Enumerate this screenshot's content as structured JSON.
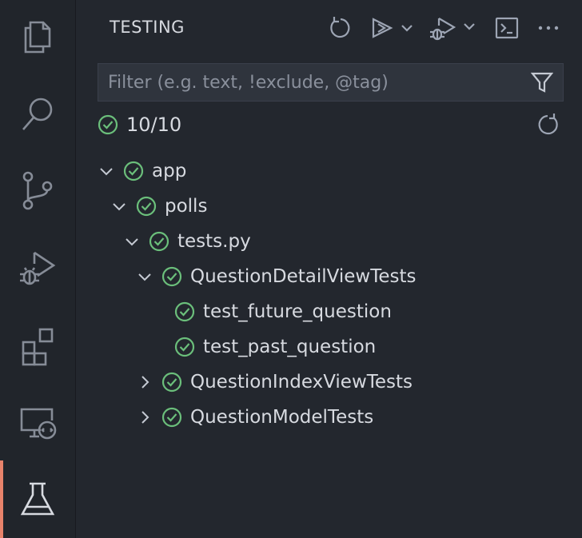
{
  "sidebar": {
    "title": "TESTING",
    "filter_placeholder": "Filter (e.g. text, !exclude, @tag)",
    "filter_value": "",
    "summary": {
      "status": "passed",
      "count": "10/10"
    }
  },
  "tree": [
    {
      "label": "app",
      "depth": 0,
      "expanded": true,
      "has_children": true
    },
    {
      "label": "polls",
      "depth": 1,
      "expanded": true,
      "has_children": true
    },
    {
      "label": "tests.py",
      "depth": 2,
      "expanded": true,
      "has_children": true
    },
    {
      "label": "QuestionDetailViewTests",
      "depth": 3,
      "expanded": true,
      "has_children": true
    },
    {
      "label": "test_future_question",
      "depth": 4,
      "expanded": false,
      "has_children": false
    },
    {
      "label": "test_past_question",
      "depth": 4,
      "expanded": false,
      "has_children": false
    },
    {
      "label": "QuestionIndexViewTests",
      "depth": 3,
      "expanded": false,
      "has_children": true
    },
    {
      "label": "QuestionModelTests",
      "depth": 3,
      "expanded": false,
      "has_children": true
    }
  ],
  "icons": {
    "activity_bar": [
      "explorer-icon",
      "search-icon",
      "source-control-icon",
      "run-and-debug-icon",
      "extensions-icon",
      "remote-explorer-icon",
      "testing-flask-icon"
    ],
    "header": [
      "refresh-tests-icon",
      "run-tests-icon",
      "debug-tests-icon",
      "terminal-icon",
      "more-actions-icon"
    ]
  },
  "colors": {
    "pass": "#6bbf7b",
    "active_indicator": "#e8836b",
    "icon": "#9da5b4"
  }
}
